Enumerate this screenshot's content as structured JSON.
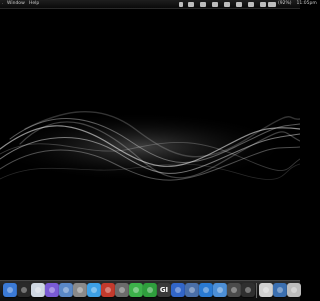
{
  "menubar": {
    "menus": [
      "Window",
      "Help"
    ],
    "status": {
      "time": "11:05pm",
      "battery_percent": "(92%)"
    }
  },
  "dock": {
    "items": [
      {
        "name": "finder",
        "icon": "finder-icon",
        "color": "#3b7ad6"
      },
      {
        "name": "dashboard",
        "icon": "dashboard-icon",
        "color": "#2a2a2a"
      },
      {
        "name": "safari",
        "icon": "safari-compass-icon",
        "color": "#cfd8e3"
      },
      {
        "name": "itunes",
        "icon": "music-note-icon",
        "color": "#7a5bd6"
      },
      {
        "name": "preview",
        "icon": "preview-icon",
        "color": "#5a88c6"
      },
      {
        "name": "system-preferences",
        "icon": "gear-icon",
        "color": "#8a8a8a"
      },
      {
        "name": "twitter",
        "icon": "twitter-bird-icon",
        "color": "#3da0e6"
      },
      {
        "name": "app",
        "icon": "app-icon",
        "color": "#c23a2d"
      },
      {
        "name": "photo",
        "icon": "photo-icon",
        "color": "#6b6b6b"
      },
      {
        "name": "app-green",
        "icon": "leaf-icon",
        "color": "#3cb14a"
      },
      {
        "name": "app-green-2",
        "icon": "app-icon",
        "color": "#2f9e3d"
      },
      {
        "name": "gi",
        "icon": "gi-icon",
        "color": "#3a3a3a",
        "text": "GI"
      },
      {
        "name": "app-blue",
        "icon": "app-icon",
        "color": "#3266c8"
      },
      {
        "name": "app-eagle",
        "icon": "eagle-icon",
        "color": "#4a6fa8"
      },
      {
        "name": "app-blue-2",
        "icon": "app-icon",
        "color": "#2a7ad2"
      },
      {
        "name": "folder",
        "icon": "folder-icon",
        "color": "#4d8fd6"
      },
      {
        "name": "app-dark",
        "icon": "app-icon",
        "color": "#4b4b4b"
      },
      {
        "name": "app-dark-2",
        "icon": "app-icon",
        "color": "#2f2f2f"
      },
      {
        "name": "window-preview",
        "icon": "window-icon",
        "color": "#d0d0d0"
      },
      {
        "name": "folder-stack",
        "icon": "folder-icon",
        "color": "#3b6fb0"
      },
      {
        "name": "trash",
        "icon": "trash-icon",
        "color": "#bcbcbc"
      }
    ]
  }
}
